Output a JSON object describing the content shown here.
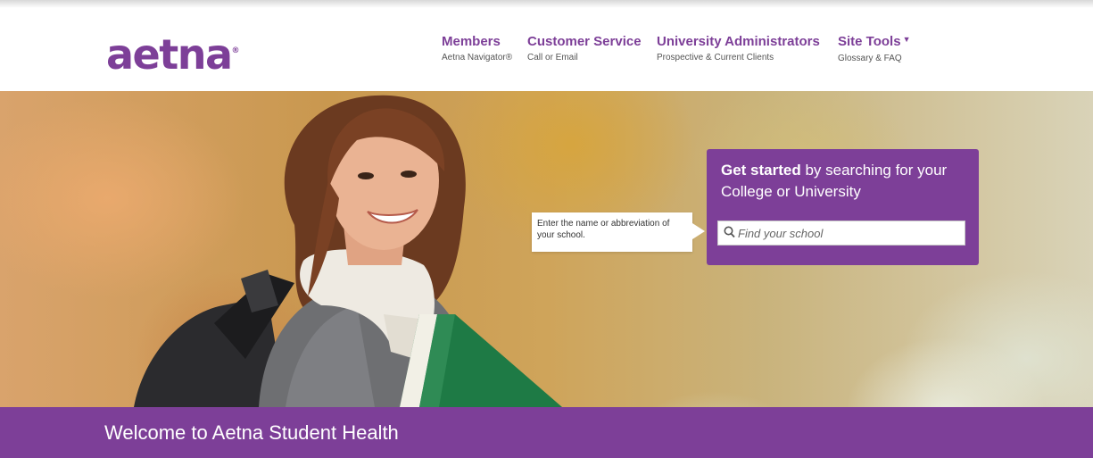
{
  "brand": {
    "logo_text": "aetna",
    "logo_mark": "®",
    "color": "#7d3f98"
  },
  "nav": [
    {
      "title": "Members",
      "subtitle": "Aetna Navigator®"
    },
    {
      "title": "Customer Service",
      "subtitle": "Call or Email"
    },
    {
      "title": "University Administrators",
      "subtitle": "Prospective & Current Clients"
    },
    {
      "title": "Site Tools",
      "subtitle": "Glossary & FAQ",
      "icon": "caret-down-icon"
    }
  ],
  "hero": {
    "tooltip": "Enter the name or abbreviation of your school.",
    "headline_bold": "Get started",
    "headline_rest": " by searching for your College or University",
    "search_placeholder": "Find your school",
    "search_icon": "search-icon"
  },
  "welcome": {
    "text": "Welcome to Aetna Student Health"
  }
}
